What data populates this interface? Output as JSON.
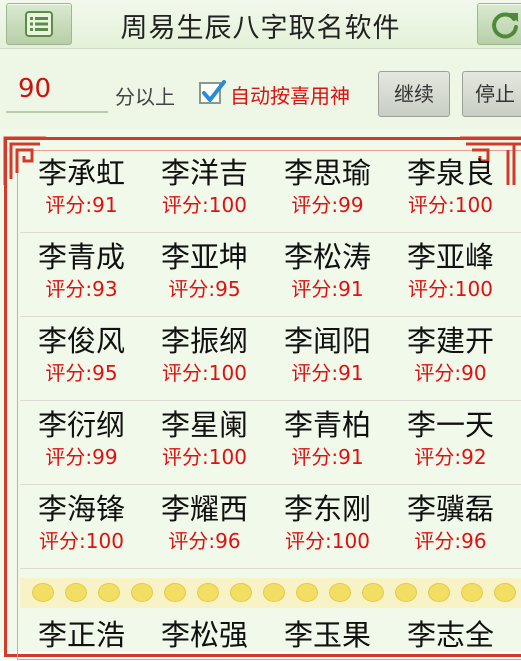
{
  "app": {
    "title": "周易生辰八字取名软件"
  },
  "icons": {
    "menu": "list-menu-icon",
    "refresh": "refresh-icon",
    "checkbox_mark": "checkmark-icon"
  },
  "controls": {
    "score_value": "90",
    "score_suffix": "分以上",
    "auto_checked": true,
    "auto_label": "自动按喜用神",
    "continue_label": "继续",
    "stop_label": "停止"
  },
  "colors": {
    "accent_red": "#dd1111",
    "frame_red": "#d43a2a",
    "bar_green": "#e3f1d8",
    "dot_yellow": "#f2de63"
  },
  "results": [
    [
      {
        "name": "李承虹",
        "score": "评分:91"
      },
      {
        "name": "李洋吉",
        "score": "评分:100"
      },
      {
        "name": "李思瑜",
        "score": "评分:99"
      },
      {
        "name": "李泉良",
        "score": "评分:100"
      }
    ],
    [
      {
        "name": "李青成",
        "score": "评分:93"
      },
      {
        "name": "李亚坤",
        "score": "评分:95"
      },
      {
        "name": "李松涛",
        "score": "评分:91"
      },
      {
        "name": "李亚峰",
        "score": "评分:100"
      }
    ],
    [
      {
        "name": "李俊风",
        "score": "评分:95"
      },
      {
        "name": "李振纲",
        "score": "评分:100"
      },
      {
        "name": "李闻阳",
        "score": "评分:91"
      },
      {
        "name": "李建开",
        "score": "评分:90"
      }
    ],
    [
      {
        "name": "李衍纲",
        "score": "评分:99"
      },
      {
        "name": "李星阑",
        "score": "评分:100"
      },
      {
        "name": "李青柏",
        "score": "评分:91"
      },
      {
        "name": "李一天",
        "score": "评分:92"
      }
    ],
    [
      {
        "name": "李海锋",
        "score": "评分:100"
      },
      {
        "name": "李耀西",
        "score": "评分:96"
      },
      {
        "name": "李东刚",
        "score": "评分:100"
      },
      {
        "name": "李骥磊",
        "score": "评分:96"
      }
    ]
  ],
  "next_batch": [
    {
      "name": "李正浩"
    },
    {
      "name": "李松强"
    },
    {
      "name": "李玉果"
    },
    {
      "name": "李志全"
    }
  ]
}
